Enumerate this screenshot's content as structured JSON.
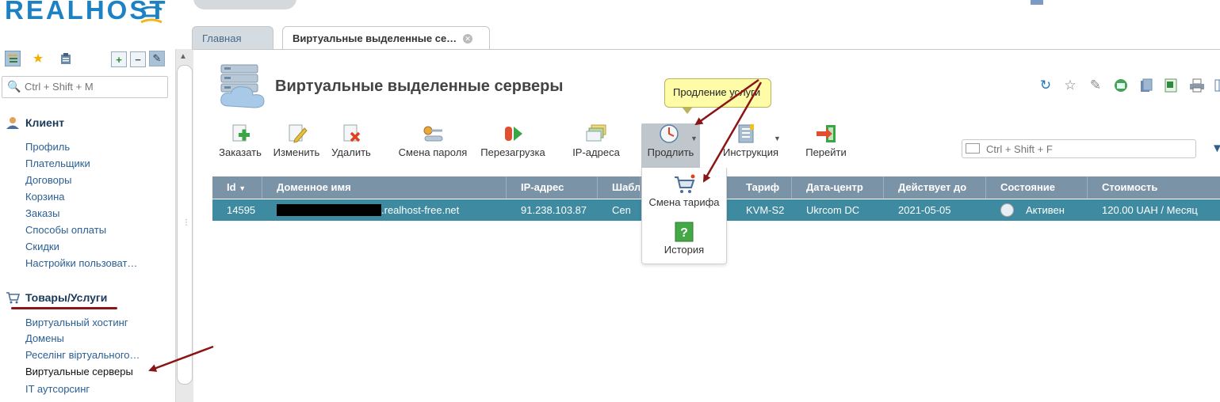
{
  "brand": {
    "logo": "REALHOST"
  },
  "colors": {
    "accent": "#1d82c4",
    "row_selected": "#3e8aa0",
    "header": "#7b93a7",
    "annotation": "#8b1414",
    "tooltip": "#fffca8"
  },
  "sidebar": {
    "search_placeholder": "Ctrl + Shift + M",
    "toolbar_icons": [
      "tree-icon",
      "star-icon",
      "clipboard-icon",
      "expand-icon",
      "collapse-icon",
      "pin-icon"
    ],
    "sections": [
      {
        "title": "Клиент",
        "icon": "user-icon",
        "items": [
          "Профиль",
          "Плательщики",
          "Договоры",
          "Корзина",
          "Заказы",
          "Способы оплаты",
          "Скидки",
          "Настройки пользоват…"
        ]
      },
      {
        "title": "Товары/Услуги",
        "icon": "cart-icon",
        "items": [
          "Виртуальный хостинг",
          "Домены",
          "Реселінг віртуального…",
          "Виртуальные серверы",
          "IT аутсорсинг"
        ]
      }
    ],
    "active_item": "Виртуальные серверы"
  },
  "tabs": [
    {
      "label": "Главная",
      "active": false
    },
    {
      "label": "Виртуальные выделенные се…",
      "active": true
    }
  ],
  "page": {
    "title": "Виртуальные выделенные серверы",
    "right_icons": [
      "refresh-icon",
      "star-icon",
      "pin-icon",
      "vnc-icon",
      "copy-icon",
      "excel-icon",
      "print-icon",
      "columns-icon"
    ]
  },
  "toolbar": {
    "order": "Заказать",
    "edit": "Изменить",
    "delete": "Удалить",
    "change_password": "Смена пароля",
    "reboot": "Перезагрузка",
    "ip_addresses": "IP-адреса",
    "prolong": "Продлить",
    "instruction": "Инструкция",
    "goto": "Перейти",
    "search_placeholder": "Ctrl + Shift + F"
  },
  "dropdown": {
    "items": [
      {
        "label": "Смена тарифа",
        "icon": "cart-icon"
      },
      {
        "label": "История",
        "icon": "help-icon"
      }
    ]
  },
  "tooltip": {
    "text": "Продление услуги"
  },
  "table": {
    "columns": [
      "Id",
      "Доменное имя",
      "IP-адрес",
      "Шаблон",
      "Тариф",
      "Дата-центр",
      "Действует до",
      "Состояние",
      "Стоимость"
    ],
    "rows": [
      {
        "id": "14595",
        "domain": ".realhost-free.net",
        "ip": "91.238.103.87",
        "template": "Cen",
        "tariff": "KVM-S2",
        "datacenter": "Ukrcom DC",
        "valid_until": "2021-05-05",
        "status": "Активен",
        "price": "120.00 UAH / Месяц"
      }
    ]
  }
}
